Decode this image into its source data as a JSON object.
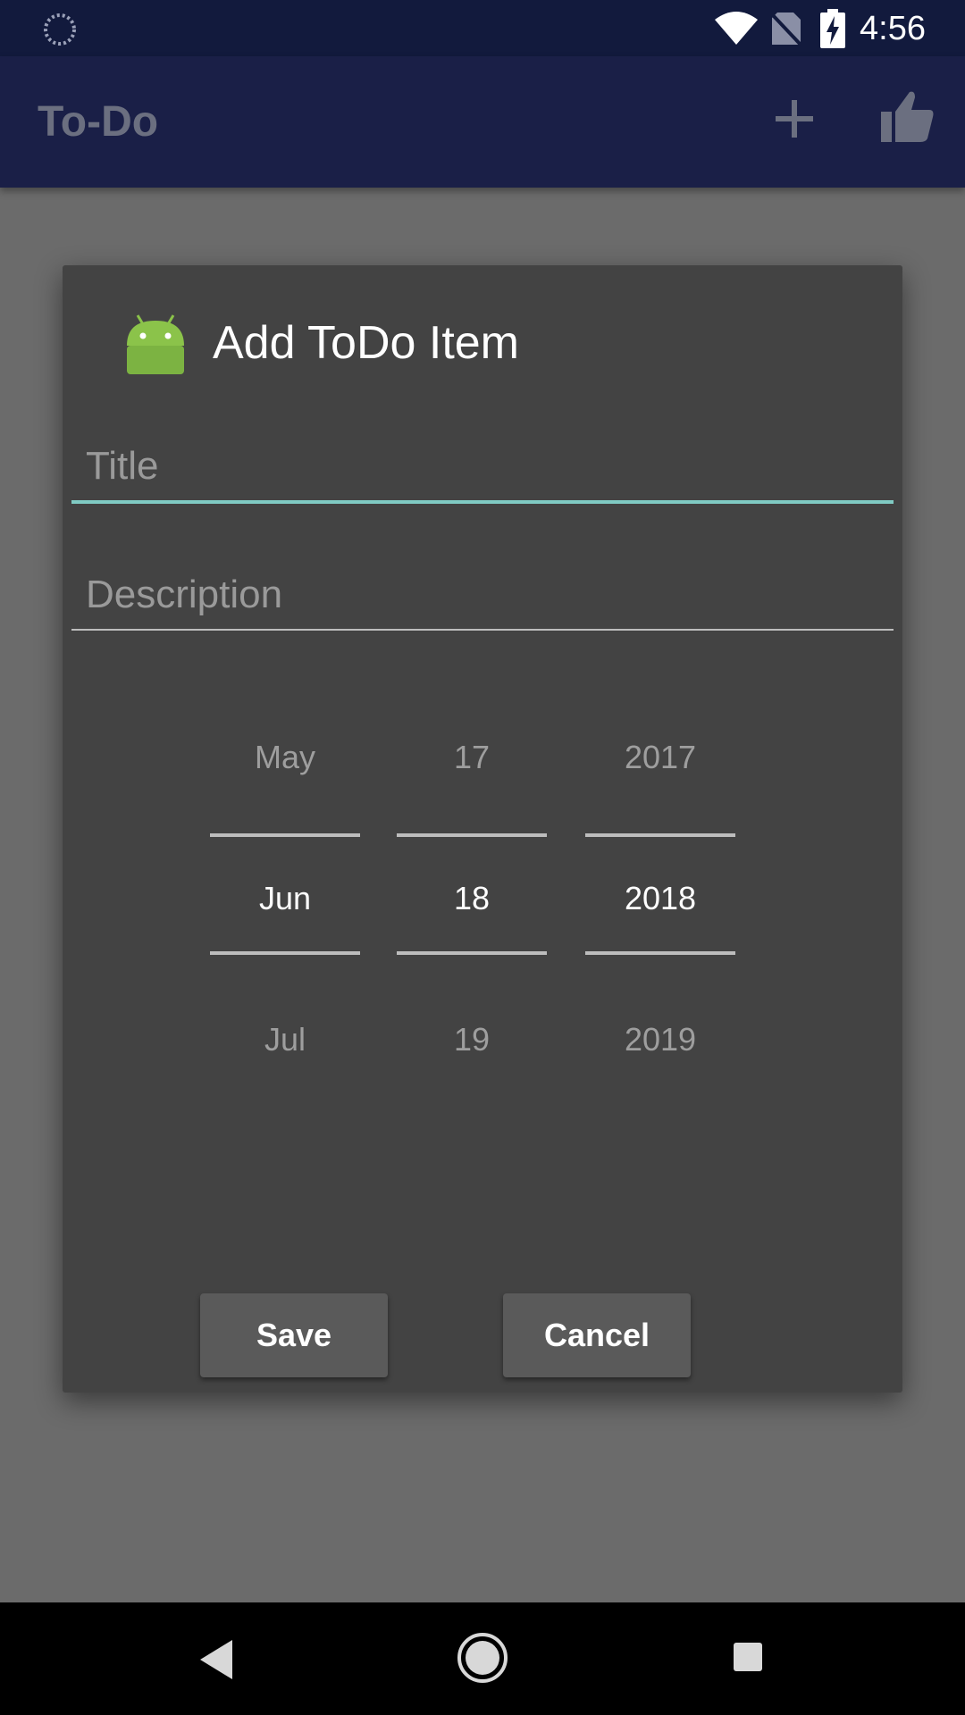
{
  "status_bar": {
    "time": "4:56",
    "icons": [
      "loading-icon",
      "wifi-icon",
      "no-sim-icon",
      "battery-charging-icon"
    ]
  },
  "app_bar": {
    "title": "To-Do",
    "actions": [
      "add-icon",
      "thumb-up-icon"
    ]
  },
  "dialog": {
    "title": "Add ToDo Item",
    "icon": "android-icon",
    "title_field": {
      "placeholder": "Title",
      "value": ""
    },
    "description_field": {
      "placeholder": "Description",
      "value": ""
    },
    "date_picker": {
      "month": {
        "prev": "May",
        "current": "Jun",
        "next": "Jul"
      },
      "day": {
        "prev": "17",
        "current": "18",
        "next": "19"
      },
      "year": {
        "prev": "2017",
        "current": "2018",
        "next": "2019"
      }
    },
    "buttons": {
      "save": "Save",
      "cancel": "Cancel"
    }
  },
  "nav_bar": {
    "icons": [
      "back-icon",
      "home-icon",
      "recents-icon"
    ]
  },
  "colors": {
    "status_bar": "#121a3d",
    "app_bar": "#1a1f47",
    "scrim": "#6b6b6b",
    "dialog_bg": "#434343",
    "accent": "#80cbc4",
    "android_green": "#8bc34a"
  }
}
